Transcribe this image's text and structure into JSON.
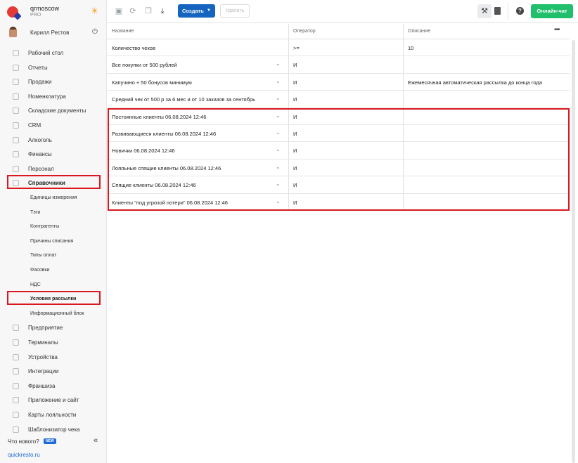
{
  "brand": {
    "name": "qrmoscow",
    "plan": "PRO"
  },
  "user": {
    "name": "Кирилл Рестов"
  },
  "sidebar": {
    "items": [
      {
        "label": "Рабочий стол",
        "icon": "dashboard-icon"
      },
      {
        "label": "Отчеты",
        "icon": "reports-icon"
      },
      {
        "label": "Продажи",
        "icon": "sales-icon"
      },
      {
        "label": "Номенклатура",
        "icon": "nomenclature-icon"
      },
      {
        "label": "Складские документы",
        "icon": "warehouse-icon"
      },
      {
        "label": "CRM",
        "icon": "crm-icon"
      },
      {
        "label": "Алкоголь",
        "icon": "alcohol-icon"
      },
      {
        "label": "Финансы",
        "icon": "finance-icon"
      },
      {
        "label": "Персонал",
        "icon": "staff-icon"
      },
      {
        "label": "Справочники",
        "icon": "reference-icon",
        "active": true
      }
    ],
    "subitems": [
      {
        "label": "Единицы измерения"
      },
      {
        "label": "Тэги"
      },
      {
        "label": "Контрагенты"
      },
      {
        "label": "Причины списания"
      },
      {
        "label": "Типы оплат"
      },
      {
        "label": "Фасовки"
      },
      {
        "label": "НДС"
      },
      {
        "label": "Условия рассылки",
        "active": true
      },
      {
        "label": "Информационный блок"
      }
    ],
    "items2": [
      {
        "label": "Предприятие",
        "icon": "enterprise-icon"
      },
      {
        "label": "Терминалы",
        "icon": "terminal-icon"
      },
      {
        "label": "Устройства",
        "icon": "devices-icon"
      },
      {
        "label": "Интеграции",
        "icon": "integrations-icon"
      },
      {
        "label": "Франшиза",
        "icon": "franchise-icon"
      },
      {
        "label": "Приложение и сайт",
        "icon": "app-icon"
      },
      {
        "label": "Карты лояльности",
        "icon": "loyalty-icon"
      },
      {
        "label": "Шаблонизатор чека",
        "icon": "receipt-icon"
      }
    ],
    "whats_new": "Что нового?",
    "new_badge": "NEW",
    "site_link": "quickresto.ru"
  },
  "toolbar": {
    "create_label": "Создать",
    "delete_label": "Удалить",
    "chat_label": "Онлайн-чат"
  },
  "table": {
    "headers": {
      "name": "Название",
      "operator": "Оператор",
      "description": "Описание"
    },
    "rows": [
      {
        "name": "Количество чеков",
        "operator": ">=",
        "description": "10",
        "expandable": false
      },
      {
        "name": "Все покупки от 500 рублей",
        "operator": "И",
        "description": "",
        "expandable": true
      },
      {
        "name": "Капучино + 50 бонусов минимум",
        "operator": "И",
        "description": "Ежемесячная автоматическая рассылка до конца года",
        "expandable": true
      },
      {
        "name": "Средний чек от 500 р за 6 мес и от 10 заказов за сентябрь",
        "operator": "И",
        "description": "",
        "expandable": true
      },
      {
        "name": "Постоянные клиенты 06.08.2024 12:46",
        "operator": "И",
        "description": "",
        "expandable": true
      },
      {
        "name": "Развивающиеся клиенты 06.08.2024 12:46",
        "operator": "И",
        "description": "",
        "expandable": true
      },
      {
        "name": "Новички 06.08.2024 12:46",
        "operator": "И",
        "description": "",
        "expandable": true
      },
      {
        "name": "Лояльные спящие клиенты 06.08.2024 12:46",
        "operator": "И",
        "description": "",
        "expandable": true
      },
      {
        "name": "Спящие клиенты 06.08.2024 12:46",
        "operator": "И",
        "description": "",
        "expandable": true
      },
      {
        "name": "Клиенты \"под угрозой потери\" 06.08.2024 12:46",
        "operator": "И",
        "description": "",
        "expandable": true
      }
    ]
  },
  "colors": {
    "accent": "#1565c0",
    "chat": "#1fbf6b",
    "highlight": "#d9181f"
  }
}
